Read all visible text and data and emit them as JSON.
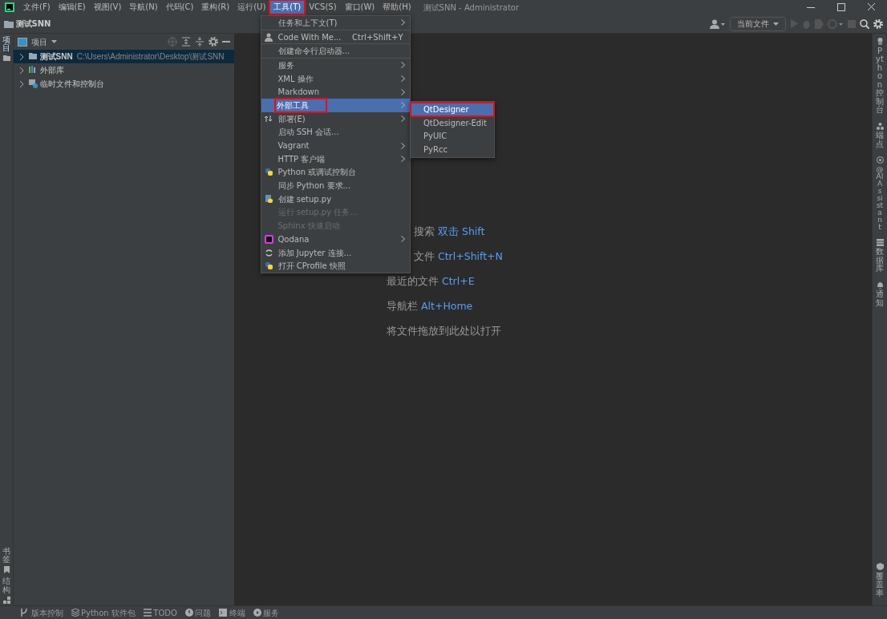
{
  "window": {
    "title": "测试SNN - Administrator"
  },
  "menu_bar": [
    {
      "label": "文件(F)",
      "selected": false,
      "outlined": false
    },
    {
      "label": "编辑(E)",
      "selected": false,
      "outlined": false
    },
    {
      "label": "视图(V)",
      "selected": false,
      "outlined": false
    },
    {
      "label": "导航(N)",
      "selected": false,
      "outlined": false
    },
    {
      "label": "代码(C)",
      "selected": false,
      "outlined": false
    },
    {
      "label": "重构(R)",
      "selected": false,
      "outlined": false
    },
    {
      "label": "运行(U)",
      "selected": false,
      "outlined": false
    },
    {
      "label": "工具(T)",
      "selected": true,
      "outlined": true
    },
    {
      "label": "VCS(S)",
      "selected": false,
      "outlined": false
    },
    {
      "label": "窗口(W)",
      "selected": false,
      "outlined": false
    },
    {
      "label": "帮助(H)",
      "selected": false,
      "outlined": false
    }
  ],
  "breadcrumb": "测试SNN",
  "toolbar": {
    "run_config": "当前文件"
  },
  "left_strip": [
    {
      "label": "项目",
      "selected": true
    },
    {
      "label": "书签",
      "selected": false
    },
    {
      "label": "结构",
      "selected": false
    }
  ],
  "project_panel": {
    "title": "项目",
    "tree": [
      {
        "label": "测试SNN",
        "path": "C:\\Users\\Administrator\\Desktop\\测试SNN",
        "selected": true,
        "expanded": false
      },
      {
        "label": "外部库",
        "selected": false,
        "expanded": false
      },
      {
        "label": "临时文件和控制台",
        "selected": false,
        "expanded": false
      }
    ]
  },
  "editor_hints": [
    {
      "label": "搜索",
      "shortcut": "双击 Shift"
    },
    {
      "label": "文件",
      "shortcut": "Ctrl+Shift+N"
    },
    {
      "label": "最近的文件",
      "shortcut": "Ctrl+E"
    },
    {
      "label": "导航栏",
      "shortcut": "Alt+Home"
    },
    {
      "label": "将文件拖放到此处以打开"
    }
  ],
  "tools_menu": [
    {
      "kind": "item",
      "label": "任务和上下文(T)",
      "submenu": true,
      "icon": false,
      "disabled": false,
      "selected": false,
      "outlined": false
    },
    {
      "kind": "separator"
    },
    {
      "kind": "item",
      "label": "Code With Me...",
      "shortcut": "Ctrl+Shift+Y",
      "submenu": false,
      "icon": true,
      "disabled": false,
      "selected": false,
      "outlined": false
    },
    {
      "kind": "separator"
    },
    {
      "kind": "item",
      "label": "创建命令行启动器...",
      "submenu": false,
      "icon": false,
      "disabled": false,
      "selected": false,
      "outlined": false
    },
    {
      "kind": "separator"
    },
    {
      "kind": "item",
      "label": "服务",
      "submenu": true,
      "icon": false,
      "disabled": false,
      "selected": false,
      "outlined": false
    },
    {
      "kind": "item",
      "label": "XML 操作",
      "submenu": true,
      "icon": false,
      "disabled": false,
      "selected": false,
      "outlined": false
    },
    {
      "kind": "item",
      "label": "Markdown",
      "submenu": true,
      "icon": false,
      "disabled": false,
      "selected": false,
      "outlined": false
    },
    {
      "kind": "item",
      "label": "外部工具",
      "submenu": true,
      "icon": false,
      "disabled": false,
      "selected": true,
      "outlined": true
    },
    {
      "kind": "item",
      "label": "部署(E)",
      "submenu": true,
      "icon": true,
      "disabled": false,
      "selected": false,
      "outlined": false
    },
    {
      "kind": "item",
      "label": "启动 SSH 会话...",
      "submenu": false,
      "icon": false,
      "disabled": false,
      "selected": false,
      "outlined": false
    },
    {
      "kind": "item",
      "label": "Vagrant",
      "submenu": true,
      "icon": false,
      "disabled": false,
      "selected": false,
      "outlined": false
    },
    {
      "kind": "item",
      "label": "HTTP 客户端",
      "submenu": true,
      "icon": false,
      "disabled": false,
      "selected": false,
      "outlined": false
    },
    {
      "kind": "item",
      "label": "Python 或调试控制台",
      "submenu": false,
      "icon": true,
      "disabled": false,
      "selected": false,
      "outlined": false
    },
    {
      "kind": "item",
      "label": "同步 Python 要求...",
      "submenu": false,
      "icon": false,
      "disabled": false,
      "selected": false,
      "outlined": false
    },
    {
      "kind": "item",
      "label": "创建 setup.py",
      "submenu": false,
      "icon": true,
      "disabled": false,
      "selected": false,
      "outlined": false
    },
    {
      "kind": "item",
      "label": "运行 setup.py 任务...",
      "submenu": false,
      "icon": false,
      "disabled": true,
      "selected": false,
      "outlined": false
    },
    {
      "kind": "item",
      "label": "Sphinx 快速启动",
      "submenu": false,
      "icon": false,
      "disabled": true,
      "selected": false,
      "outlined": false
    },
    {
      "kind": "item",
      "label": "Qodana",
      "submenu": true,
      "icon": true,
      "disabled": false,
      "selected": false,
      "outlined": false
    },
    {
      "kind": "item",
      "label": "添加 Jupyter 连接...",
      "submenu": false,
      "icon": true,
      "disabled": false,
      "selected": false,
      "outlined": false
    },
    {
      "kind": "item",
      "label": "打开 CProfile 快照",
      "submenu": false,
      "icon": true,
      "disabled": false,
      "selected": false,
      "outlined": false
    }
  ],
  "external_tools_menu": [
    {
      "label": "QtDesigner",
      "selected": true,
      "outlined": true
    },
    {
      "label": "QtDesigner-Edit",
      "selected": false,
      "outlined": false
    },
    {
      "label": "PyUIC",
      "selected": false,
      "outlined": false
    },
    {
      "label": "PyRcc",
      "selected": false,
      "outlined": false
    }
  ],
  "right_strip": [
    {
      "label": "Python 控制台"
    },
    {
      "label": "端点"
    },
    {
      "label": "@ AI Assistant"
    },
    {
      "label": "数据库"
    },
    {
      "label": "通知"
    },
    {
      "label": "覆盖率"
    }
  ],
  "status_bar": [
    {
      "label": "版本控制"
    },
    {
      "label": "Python 软件包"
    },
    {
      "label": "TODO"
    },
    {
      "label": "问题"
    },
    {
      "label": "终端"
    },
    {
      "label": "服务"
    }
  ]
}
